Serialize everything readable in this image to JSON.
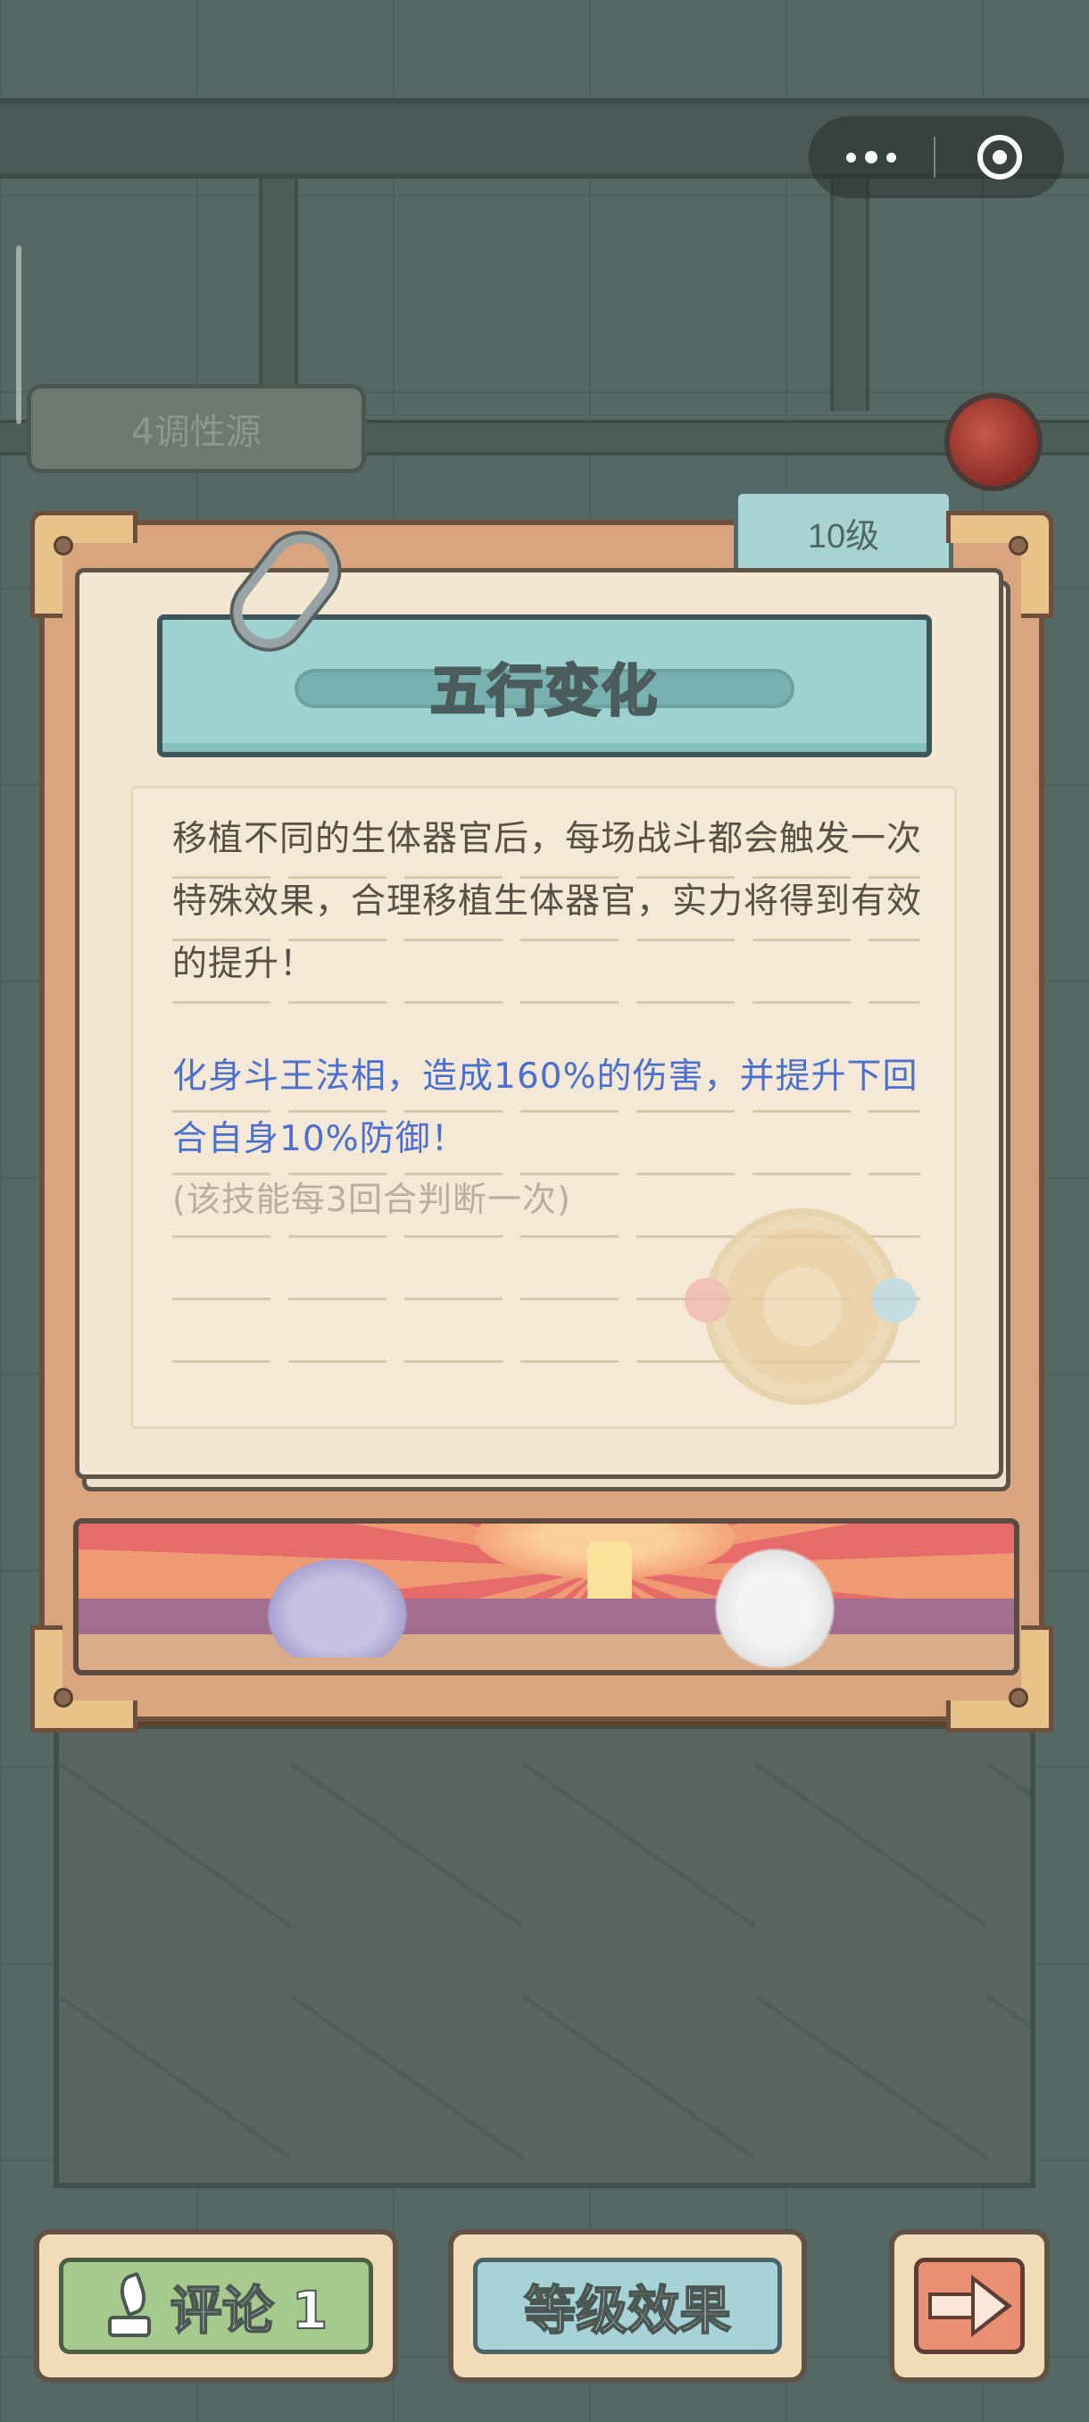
{
  "background": {
    "faded_badge_text": "4调性源"
  },
  "capsule": {
    "more_icon": "more-dots-icon",
    "close_icon": "target-circle-icon"
  },
  "card": {
    "level_label": "10级",
    "title": "五行变化",
    "description": "移植不同的生体器官后，每场战斗都会触发一次特殊效果，合理移植生体器官，实力将得到有效的提升！",
    "skill_effect": "化身斗王法相，造成160%的伤害，并提升下回合自身10%防御！",
    "skill_note": "(该技能每3回合判断一次)"
  },
  "buttons": {
    "comment_label": "评论 1",
    "comment_icon": "quill-pen-icon",
    "level_effect_label": "等级效果",
    "next_icon": "arrow-right-icon"
  },
  "colors": {
    "skill_text": "#4d6fcd",
    "title_bar": "#9fd1d0",
    "comment_button": "#a6c98d",
    "level_button": "#a7d2d7",
    "next_button": "#e98f74"
  }
}
